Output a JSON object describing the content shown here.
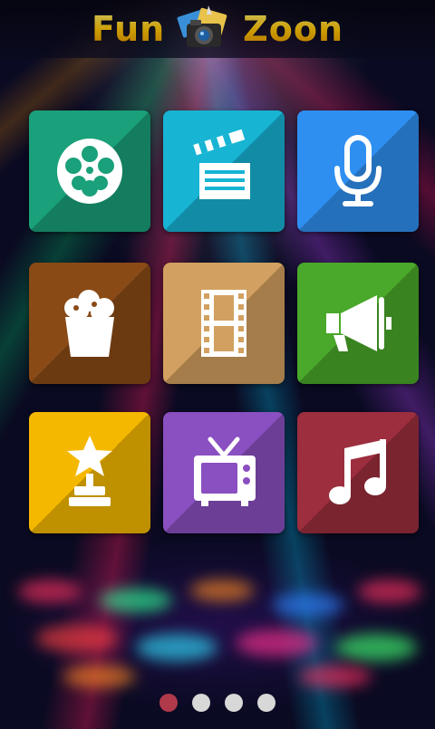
{
  "header": {
    "title_left": "Fun",
    "title_right": "Zoon",
    "logo_icon": "camera-photos-icon"
  },
  "tiles": [
    {
      "name": "film-reel",
      "icon": "film-reel-icon",
      "color": "#1aa07a"
    },
    {
      "name": "clapperboard",
      "icon": "clapperboard-icon",
      "color": "#17b4d4"
    },
    {
      "name": "microphone",
      "icon": "microphone-icon",
      "color": "#2f8ff0"
    },
    {
      "name": "popcorn",
      "icon": "popcorn-icon",
      "color": "#8a4a16"
    },
    {
      "name": "film-strip",
      "icon": "film-strip-icon",
      "color": "#d2a060"
    },
    {
      "name": "megaphone",
      "icon": "megaphone-icon",
      "color": "#4aa82a"
    },
    {
      "name": "award",
      "icon": "star-trophy-icon",
      "color": "#f5b800"
    },
    {
      "name": "tv",
      "icon": "tv-icon",
      "color": "#8a4fc0"
    },
    {
      "name": "music",
      "icon": "music-note-icon",
      "color": "#9c2e3e"
    }
  ],
  "pager": {
    "page_count": 4,
    "active_page": 1,
    "active_color": "#b03a4a",
    "inactive_color": "#d8d8d8"
  }
}
